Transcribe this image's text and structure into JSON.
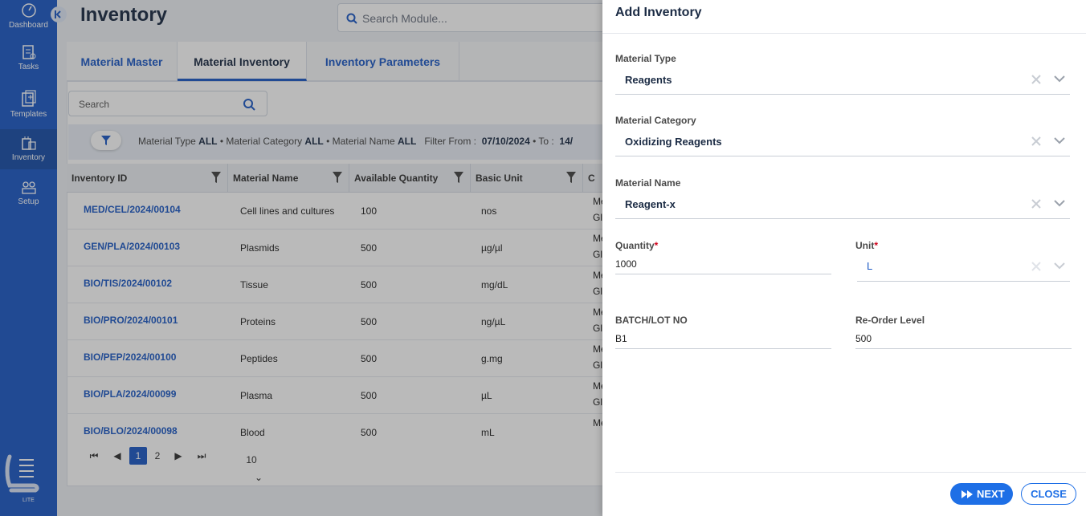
{
  "sidebar": {
    "items": [
      {
        "label": "Dashboard",
        "icon": "gauge-icon"
      },
      {
        "label": "Tasks",
        "icon": "tasks-icon"
      },
      {
        "label": "Templates",
        "icon": "templates-icon"
      },
      {
        "label": "Inventory",
        "icon": "inventory-icon"
      },
      {
        "label": "Setup",
        "icon": "setup-icon"
      }
    ],
    "logo_text": "LITE"
  },
  "header": {
    "title": "Inventory",
    "search_placeholder": "Search Module..."
  },
  "tabs": [
    {
      "label": "Material Master"
    },
    {
      "label": "Material Inventory"
    },
    {
      "label": "Inventory Parameters"
    }
  ],
  "table_search": {
    "placeholder": "Search"
  },
  "filter": {
    "material_type_label": "Material Type",
    "material_type_value": "ALL",
    "material_category_label": "Material Category",
    "material_category_value": "ALL",
    "material_name_label": "Material Name",
    "material_name_value": "ALL",
    "filter_from_label": "Filter From :",
    "filter_from_value": "07/10/2024",
    "to_label": "To :",
    "to_value": "14/"
  },
  "table": {
    "columns": [
      "Inventory ID",
      "Material Name",
      "Available Quantity",
      "Basic Unit",
      "C"
    ],
    "rows": [
      {
        "id": "MED/CEL/2024/00104",
        "name": "Cell lines and cultures",
        "qty": "100",
        "unit": "nos",
        "extra1": "Me",
        "extra2": "Gl"
      },
      {
        "id": "GEN/PLA/2024/00103",
        "name": "Plasmids",
        "qty": "500",
        "unit": "µg/µl",
        "extra1": "Me",
        "extra2": "Gl"
      },
      {
        "id": "BIO/TIS/2024/00102",
        "name": "Tissue",
        "qty": "500",
        "unit": "mg/dL",
        "extra1": "Me",
        "extra2": "Gl"
      },
      {
        "id": "BIO/PRO/2024/00101",
        "name": "Proteins",
        "qty": "500",
        "unit": "ng/µL",
        "extra1": "Me",
        "extra2": "Gl"
      },
      {
        "id": "BIO/PEP/2024/00100",
        "name": "Peptides",
        "qty": "500",
        "unit": "g.mg",
        "extra1": "Me",
        "extra2": "Gl"
      },
      {
        "id": "BIO/PLA/2024/00099",
        "name": "Plasma",
        "qty": "500",
        "unit": "µL",
        "extra1": "Me",
        "extra2": "Gl"
      },
      {
        "id": "BIO/BLO/2024/00098",
        "name": "Blood",
        "qty": "500",
        "unit": "mL",
        "extra1": "Me",
        "extra2": ""
      }
    ]
  },
  "pagination": {
    "pages": [
      "1",
      "2"
    ],
    "current": "1",
    "page_size": "10"
  },
  "drawer": {
    "title": "Add Inventory",
    "material_type": {
      "label": "Material Type",
      "value": "Reagents"
    },
    "material_category": {
      "label": "Material Category",
      "value": "Oxidizing Reagents"
    },
    "material_name": {
      "label": "Material Name",
      "value": "Reagent-x"
    },
    "quantity": {
      "label": "Quantity",
      "value": "1000",
      "required_mark": "*"
    },
    "unit": {
      "label": "Unit",
      "value": "L",
      "required_mark": "*"
    },
    "batch": {
      "label": "BATCH/LOT NO",
      "value": "B1"
    },
    "reorder": {
      "label": "Re-Order Level",
      "value": "500"
    },
    "next_label": "NEXT",
    "close_label": "CLOSE"
  },
  "colors": {
    "sidebar": "#1e5bc6",
    "accent": "#1e6fe6",
    "link": "#1e5bc6"
  }
}
